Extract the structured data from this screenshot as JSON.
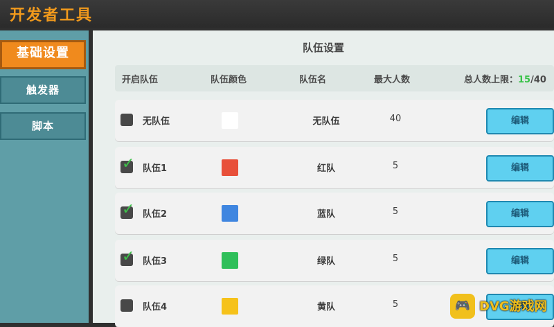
{
  "app": {
    "title": "开发者工具"
  },
  "sidebar": {
    "items": [
      {
        "label": "基础设置",
        "active": true
      },
      {
        "label": "触发器",
        "active": false
      },
      {
        "label": "脚本",
        "active": false
      }
    ]
  },
  "panel": {
    "title": "队伍设置",
    "headers": {
      "enable": "开启队伍",
      "color": "队伍颜色",
      "name": "队伍名",
      "max": "最大人数",
      "limit_label": "总人数上限：",
      "limit_current": "15",
      "limit_total": "/40"
    },
    "rows": [
      {
        "team": "无队伍",
        "display_name": "无队伍",
        "color": "#ffffff",
        "max": "40",
        "enabled": false,
        "edit_label": "编辑"
      },
      {
        "team": "队伍1",
        "display_name": "红队",
        "color": "#e8503a",
        "max": "5",
        "enabled": true,
        "edit_label": "编辑"
      },
      {
        "team": "队伍2",
        "display_name": "蓝队",
        "color": "#3f86e0",
        "max": "5",
        "enabled": true,
        "edit_label": "编辑"
      },
      {
        "team": "队伍3",
        "display_name": "绿队",
        "color": "#2fbf5a",
        "max": "5",
        "enabled": true,
        "edit_label": "编辑"
      },
      {
        "team": "队伍4",
        "display_name": "黄队",
        "color": "#f6c21a",
        "max": "5",
        "enabled": false,
        "edit_label": "编辑"
      }
    ]
  },
  "watermark": {
    "text": "DVG游戏网",
    "icon": "gamepad-icon"
  }
}
